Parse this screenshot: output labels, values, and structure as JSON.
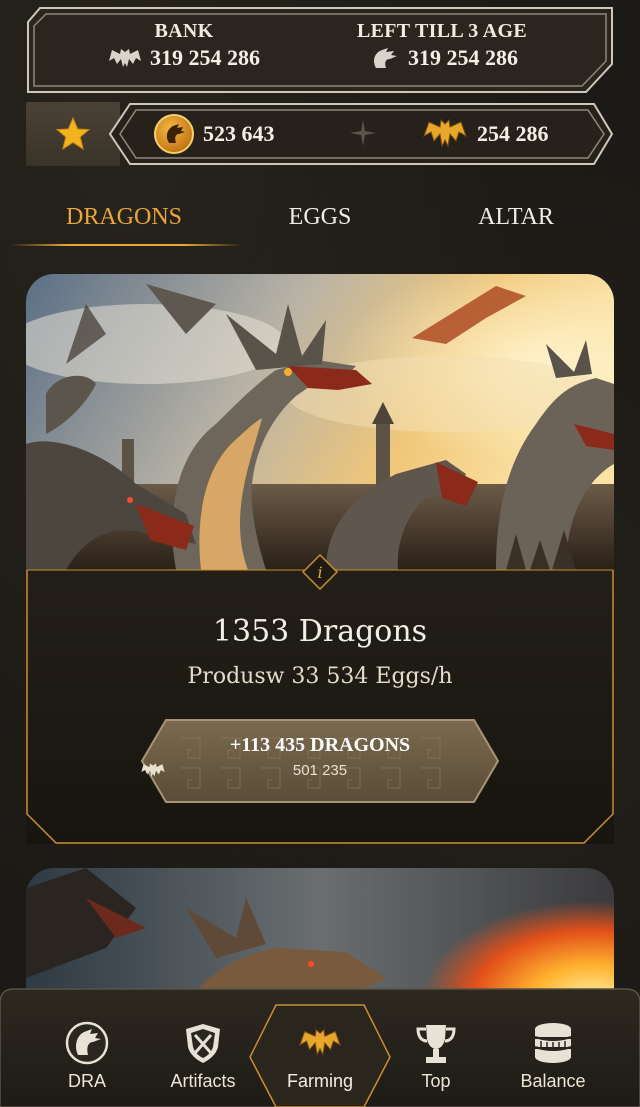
{
  "header": {
    "bank_label": "BANK",
    "bank_value": "319 254 286",
    "left_label": "LEFT TILL 3 AGE",
    "left_value": "319 254 286"
  },
  "currencies": {
    "coin_value": "523 643",
    "wing_value": "254 286"
  },
  "tabs": [
    {
      "label": "DRAGONS",
      "active": true
    },
    {
      "label": "EGGS",
      "active": false
    },
    {
      "label": "ALTAR",
      "active": false
    }
  ],
  "card": {
    "info_icon": "i",
    "title": "1353 Dragons",
    "subtitle": "Produsw 33 534 Eggs/h",
    "claim_label": "+113 435 DRAGONS",
    "claim_cost": "501 235"
  },
  "nav": [
    {
      "label": "DRA",
      "icon": "dragon-coin-icon"
    },
    {
      "label": "Artifacts",
      "icon": "shield-icon"
    },
    {
      "label": "Farming",
      "icon": "dragon-wings-icon",
      "active": true
    },
    {
      "label": "Top",
      "icon": "trophy-icon"
    },
    {
      "label": "Balance",
      "icon": "coins-stack-icon"
    }
  ],
  "colors": {
    "accent": "#e9a63a",
    "background": "#1c1a16",
    "frame": "#bdb6a8"
  }
}
